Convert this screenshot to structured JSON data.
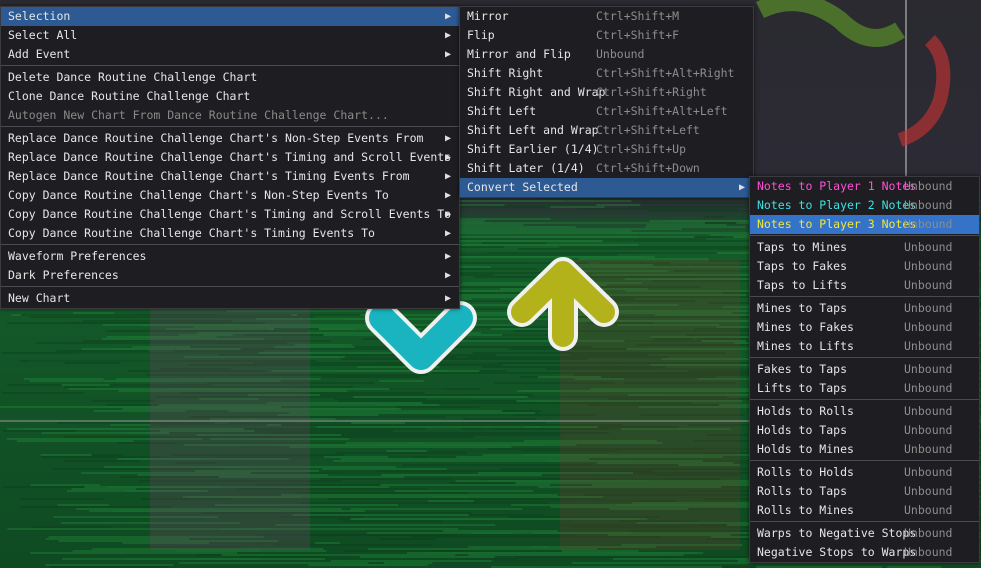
{
  "colors": {
    "selected_bg": "#2e5a94",
    "p1": "#ff4fd8",
    "p2": "#3fe0e0",
    "p3": "#f0e838",
    "arrow_cyan": "#19b4bf",
    "arrow_yellow": "#b3b21a"
  },
  "menu1": {
    "items": [
      {
        "label": "Selection",
        "submenu": true,
        "selected": true
      },
      {
        "label": "Select All",
        "submenu": true
      },
      {
        "label": "Add Event",
        "submenu": true
      },
      {
        "sep": true
      },
      {
        "label": "Delete Dance Routine Challenge Chart"
      },
      {
        "label": "Clone Dance Routine Challenge Chart"
      },
      {
        "label": "Autogen New Chart From Dance Routine Challenge Chart...",
        "disabled": true
      },
      {
        "sep": true
      },
      {
        "label": "Replace Dance Routine Challenge Chart's Non-Step Events From",
        "submenu": true
      },
      {
        "label": "Replace Dance Routine Challenge Chart's Timing and Scroll Events From",
        "submenu": true
      },
      {
        "label": "Replace Dance Routine Challenge Chart's Timing Events From",
        "submenu": true
      },
      {
        "label": "Copy Dance Routine Challenge Chart's Non-Step Events To",
        "submenu": true
      },
      {
        "label": "Copy Dance Routine Challenge Chart's Timing and Scroll Events To",
        "submenu": true
      },
      {
        "label": "Copy Dance Routine Challenge Chart's Timing Events To",
        "submenu": true
      },
      {
        "sep": true
      },
      {
        "label": "Waveform Preferences",
        "submenu": true
      },
      {
        "label": "Dark Preferences",
        "submenu": true
      },
      {
        "sep": true
      },
      {
        "label": "New Chart",
        "submenu": true
      }
    ]
  },
  "menu2": {
    "items": [
      {
        "label": "Mirror",
        "shortcut": "Ctrl+Shift+M"
      },
      {
        "label": "Flip",
        "shortcut": "Ctrl+Shift+F"
      },
      {
        "label": "Mirror and Flip",
        "shortcut": "Unbound"
      },
      {
        "label": "Shift Right",
        "shortcut": "Ctrl+Shift+Alt+Right"
      },
      {
        "label": "Shift Right and Wrap",
        "shortcut": "Ctrl+Shift+Right"
      },
      {
        "label": "Shift Left",
        "shortcut": "Ctrl+Shift+Alt+Left"
      },
      {
        "label": "Shift Left and Wrap",
        "shortcut": "Ctrl+Shift+Left"
      },
      {
        "label": "Shift Earlier (1/4)",
        "shortcut": "Ctrl+Shift+Up"
      },
      {
        "label": "Shift Later (1/4)",
        "shortcut": "Ctrl+Shift+Down"
      },
      {
        "label": "Convert Selected",
        "submenu": true,
        "selected": true
      }
    ]
  },
  "menu3": {
    "items": [
      {
        "label": "Notes to Player 1 Notes",
        "shortcut": "Unbound",
        "color": "p1"
      },
      {
        "label": "Notes to Player 2 Notes",
        "shortcut": "Unbound",
        "color": "p2"
      },
      {
        "label": "Notes to Player 3 Notes",
        "shortcut": "Unbound",
        "color": "p3",
        "selected": true
      },
      {
        "sep": true
      },
      {
        "label": "Taps to Mines",
        "shortcut": "Unbound"
      },
      {
        "label": "Taps to Fakes",
        "shortcut": "Unbound"
      },
      {
        "label": "Taps to Lifts",
        "shortcut": "Unbound"
      },
      {
        "sep": true
      },
      {
        "label": "Mines to Taps",
        "shortcut": "Unbound"
      },
      {
        "label": "Mines to Fakes",
        "shortcut": "Unbound"
      },
      {
        "label": "Mines to Lifts",
        "shortcut": "Unbound"
      },
      {
        "sep": true
      },
      {
        "label": "Fakes to Taps",
        "shortcut": "Unbound"
      },
      {
        "label": "Lifts to Taps",
        "shortcut": "Unbound"
      },
      {
        "sep": true
      },
      {
        "label": "Holds to Rolls",
        "shortcut": "Unbound"
      },
      {
        "label": "Holds to Taps",
        "shortcut": "Unbound"
      },
      {
        "label": "Holds to Mines",
        "shortcut": "Unbound"
      },
      {
        "sep": true
      },
      {
        "label": "Rolls to Holds",
        "shortcut": "Unbound"
      },
      {
        "label": "Rolls to Taps",
        "shortcut": "Unbound"
      },
      {
        "label": "Rolls to Mines",
        "shortcut": "Unbound"
      },
      {
        "sep": true
      },
      {
        "label": "Warps to Negative Stops",
        "shortcut": "Unbound"
      },
      {
        "label": "Negative Stops to Warps",
        "shortcut": "Unbound"
      }
    ]
  }
}
